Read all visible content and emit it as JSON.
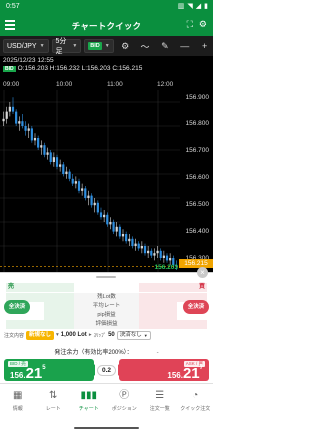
{
  "status_bar": {
    "time": "0:57"
  },
  "header": {
    "title": "チャートクイック"
  },
  "toolbar": {
    "pair": "USD/JPY",
    "timeframe": "5分足",
    "price_type": "BID"
  },
  "chart": {
    "info_line1": "2025/12/23 12:55",
    "info_badge": "BID",
    "info_line2": "O:156.203 H:156.232 L:156.203 C:156.215",
    "times": [
      "09:00",
      "10:00",
      "11:00",
      "12:00"
    ],
    "y_labels": [
      "156.900",
      "156.800",
      "156.700",
      "156.600",
      "156.500",
      "156.400",
      "156.300"
    ],
    "current_price": "156.215",
    "last_price": "156.203"
  },
  "chart_data": {
    "type": "candlestick",
    "ylim": [
      156.2,
      156.95
    ],
    "x_ticks": [
      "09:00",
      "10:00",
      "11:00",
      "12:00"
    ],
    "candles": [
      [
        156.82,
        156.86,
        156.8,
        156.83
      ],
      [
        156.83,
        156.88,
        156.81,
        156.86
      ],
      [
        156.86,
        156.9,
        156.84,
        156.88
      ],
      [
        156.88,
        156.92,
        156.85,
        156.86
      ],
      [
        156.86,
        156.87,
        156.8,
        156.81
      ],
      [
        156.81,
        156.84,
        156.78,
        156.82
      ],
      [
        156.82,
        156.85,
        156.79,
        156.8
      ],
      [
        156.8,
        156.82,
        156.76,
        156.78
      ],
      [
        156.78,
        156.81,
        156.75,
        156.79
      ],
      [
        156.79,
        156.8,
        156.73,
        156.74
      ],
      [
        156.74,
        156.77,
        156.72,
        156.75
      ],
      [
        156.75,
        156.76,
        156.7,
        156.71
      ],
      [
        156.71,
        156.74,
        156.68,
        156.72
      ],
      [
        156.72,
        156.73,
        156.67,
        156.68
      ],
      [
        156.68,
        156.71,
        156.66,
        156.69
      ],
      [
        156.69,
        156.7,
        156.64,
        156.65
      ],
      [
        156.65,
        156.69,
        156.63,
        156.67
      ],
      [
        156.67,
        156.68,
        156.62,
        156.63
      ],
      [
        156.63,
        156.66,
        156.61,
        156.64
      ],
      [
        156.64,
        156.65,
        156.59,
        156.6
      ],
      [
        156.6,
        156.63,
        156.58,
        156.61
      ],
      [
        156.61,
        156.62,
        156.57,
        156.58
      ],
      [
        156.58,
        156.6,
        156.55,
        156.56
      ],
      [
        156.56,
        156.59,
        156.54,
        156.57
      ],
      [
        156.57,
        156.58,
        156.52,
        156.53
      ],
      [
        156.53,
        156.56,
        156.51,
        156.54
      ],
      [
        156.54,
        156.55,
        156.49,
        156.5
      ],
      [
        156.5,
        156.53,
        156.47,
        156.51
      ],
      [
        156.51,
        156.52,
        156.46,
        156.47
      ],
      [
        156.47,
        156.5,
        156.44,
        156.48
      ],
      [
        156.48,
        156.49,
        156.43,
        156.44
      ],
      [
        156.44,
        156.46,
        156.41,
        156.42
      ],
      [
        156.42,
        156.45,
        156.4,
        156.43
      ],
      [
        156.43,
        156.44,
        156.38,
        156.39
      ],
      [
        156.39,
        156.42,
        156.37,
        156.4
      ],
      [
        156.4,
        156.41,
        156.35,
        156.36
      ],
      [
        156.36,
        156.4,
        156.34,
        156.38
      ],
      [
        156.38,
        156.39,
        156.33,
        156.34
      ],
      [
        156.34,
        156.37,
        156.32,
        156.35
      ],
      [
        156.35,
        156.36,
        156.31,
        156.32
      ],
      [
        156.32,
        156.35,
        156.3,
        156.33
      ],
      [
        156.33,
        156.34,
        156.29,
        156.3
      ],
      [
        156.3,
        156.33,
        156.28,
        156.31
      ],
      [
        156.31,
        156.32,
        156.28,
        156.29
      ],
      [
        156.29,
        156.32,
        156.27,
        156.3
      ],
      [
        156.3,
        156.31,
        156.26,
        156.27
      ],
      [
        156.27,
        156.3,
        156.25,
        156.28
      ],
      [
        156.28,
        156.29,
        156.25,
        156.26
      ],
      [
        156.26,
        156.29,
        156.24,
        156.27
      ],
      [
        156.27,
        156.3,
        156.25,
        156.28
      ],
      [
        156.28,
        156.29,
        156.24,
        156.25
      ],
      [
        156.25,
        156.28,
        156.23,
        156.26
      ],
      [
        156.26,
        156.27,
        156.23,
        156.24
      ],
      [
        156.24,
        156.27,
        156.22,
        156.25
      ],
      [
        156.25,
        156.26,
        156.21,
        156.22
      ],
      [
        156.22,
        156.24,
        156.2,
        156.215
      ]
    ]
  },
  "order_panel": {
    "sell_label": "売",
    "buy_label": "買",
    "rows": [
      "残Lot数",
      "平均レート",
      "pip損益",
      "評価損益"
    ],
    "settle_all_left": "全決済",
    "settle_all_right": "全決済",
    "options": {
      "order_type_label": "注文内容",
      "order_type_value": "新規なし",
      "lot_value": "1,000 Lot",
      "slippage_label": "ｽﾘｯﾌﾟ",
      "slippage_value": "50",
      "settle_value": "決済なし"
    },
    "margin_label": "発注余力（有効比率200%）：",
    "margin_value": "-"
  },
  "quote": {
    "bid_label": "BID / 売",
    "ask_label": "ASK / 買",
    "bid_small": "156.",
    "bid_big": "21",
    "bid_sup": "5",
    "ask_small": "156.",
    "ask_big": "21",
    "ask_sup": "7",
    "spread": "0.2"
  },
  "bottom_nav": [
    {
      "label": "情報"
    },
    {
      "label": "レート"
    },
    {
      "label": "チャート"
    },
    {
      "label": "ポジション"
    },
    {
      "label": "注文一覧"
    },
    {
      "label": "クイック注文"
    }
  ]
}
